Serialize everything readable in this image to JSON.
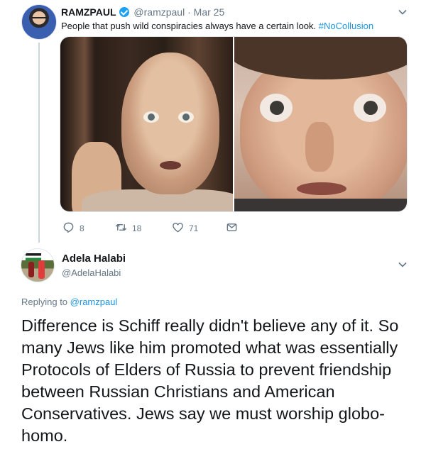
{
  "parent_tweet": {
    "display_name": "RAMZPAUL",
    "handle": "@ramzpaul",
    "separator": "·",
    "date": "Mar 25",
    "text_prefix": "People that push wild conspiracies always have a certain look.",
    "hashtag": "#NoCollusion",
    "actions": {
      "replies": "8",
      "retweets": "18",
      "likes": "71"
    },
    "icons": [
      "verified-badge-icon",
      "chevron-down-icon",
      "reply-icon",
      "retweet-icon",
      "heart-icon",
      "direct-message-icon"
    ],
    "colors": {
      "link": "#1b95e0",
      "verified": "#1da1f2",
      "muted": "#657786"
    }
  },
  "reply_tweet": {
    "display_name": "Adela Halabi",
    "handle": "@AdelaHalabi",
    "replying_prefix": "Replying to",
    "replying_mention": "@ramzpaul",
    "text": "Difference is Schiff really didn't believe any of it. So many Jews like him promoted what was essentially Protocols of Elders of Russia to prevent friendship between Russian Christians and American Conservatives. Jews say we must worship globo-homo."
  }
}
